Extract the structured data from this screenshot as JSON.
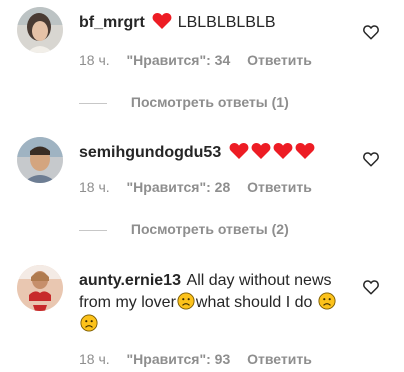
{
  "comments": [
    {
      "username": "bf_mrgrt",
      "text": "LBLBLBLBLB",
      "time": "18 ч.",
      "likes": "\"Нравится\": 34",
      "reply": "Ответить",
      "view_replies": "Посмотреть ответы (1)",
      "emoji_before": [
        "heart-emoji"
      ]
    },
    {
      "username": "semihgundogdu53",
      "text": "",
      "time": "18 ч.",
      "likes": "\"Нравится\": 28",
      "reply": "Ответить",
      "view_replies": "Посмотреть ответы (2)",
      "emoji_after": [
        "heart-emoji",
        "heart-emoji",
        "heart-emoji",
        "heart-emoji"
      ]
    },
    {
      "username": "aunty.ernie13",
      "text_part1": "All day without news from my lover",
      "text_part2": "what should I do",
      "time": "18 ч.",
      "likes": "\"Нравится\": 93",
      "reply": "Ответить"
    }
  ],
  "colors": {
    "text": "#262626",
    "secondary": "#8e8e8e",
    "heart": "#ed1c24",
    "emoji_face": "#fcc21b"
  }
}
